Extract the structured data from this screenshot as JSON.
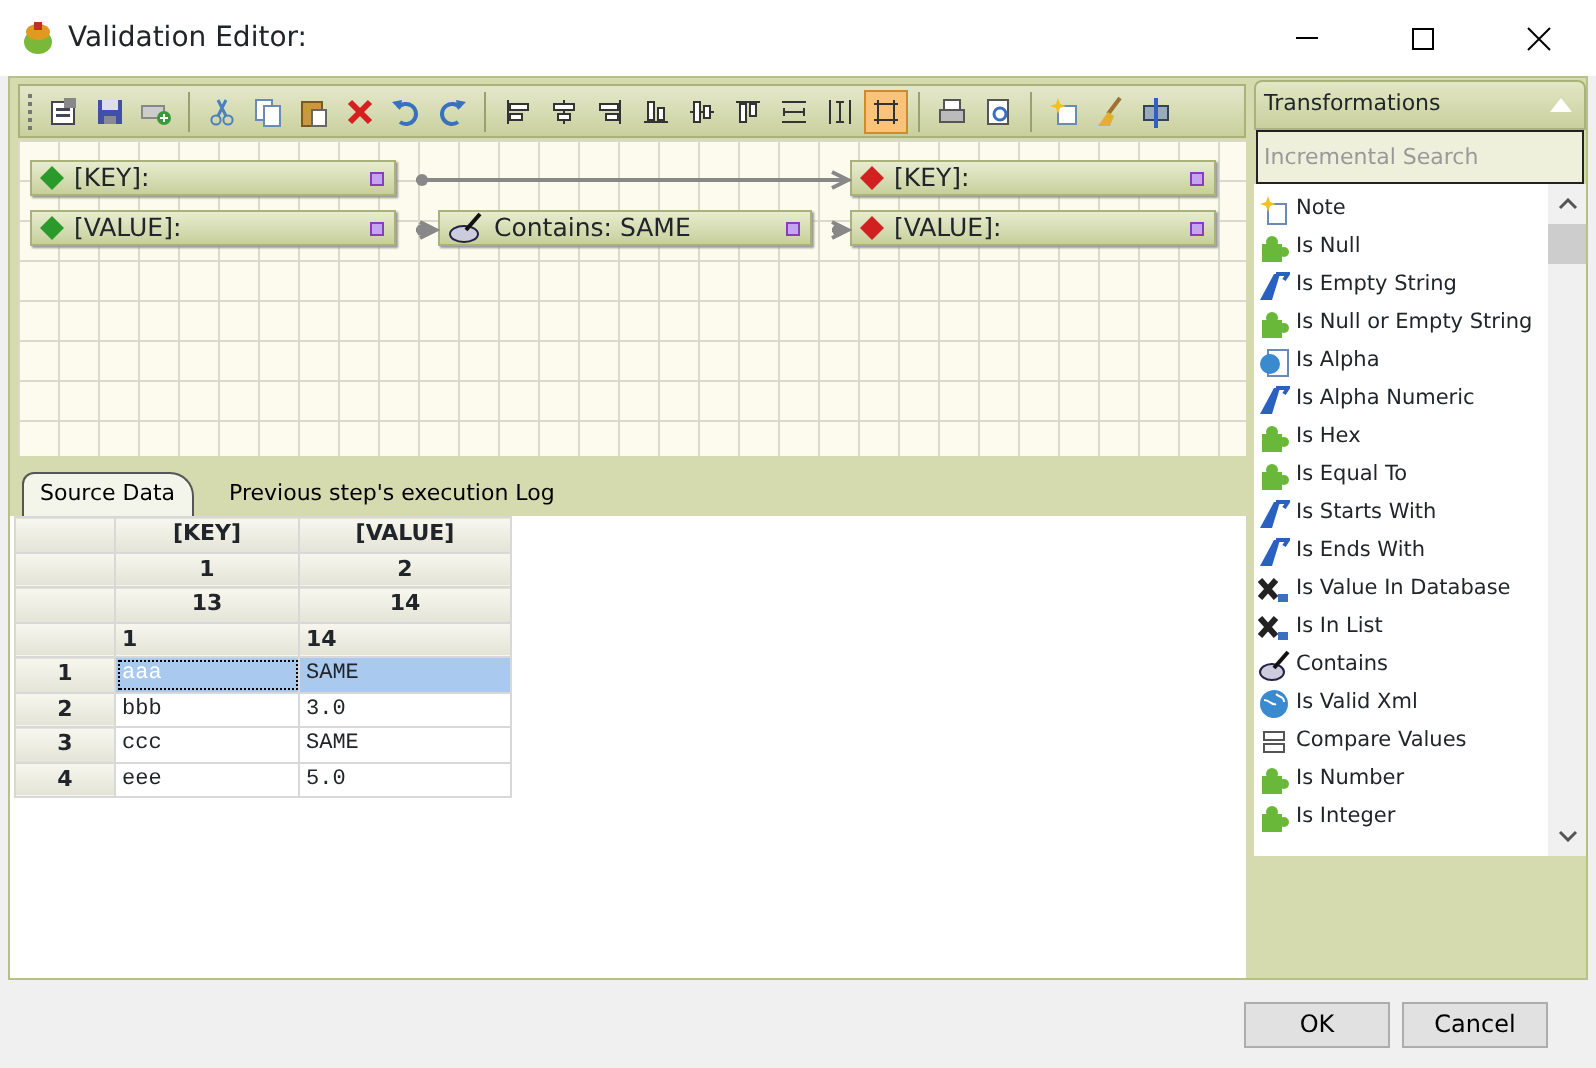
{
  "window": {
    "title": "Validation Editor:"
  },
  "toolbar_groups": [
    [
      {
        "pressed": false
      },
      {
        "pressed": false
      },
      {
        "pressed": false
      }
    ],
    [
      {
        "pressed": false
      },
      {
        "pressed": false
      },
      {
        "pressed": false
      },
      {
        "pressed": false
      },
      {
        "pressed": false
      },
      {
        "pressed": false
      }
    ],
    [
      {
        "pressed": false
      },
      {
        "pressed": false
      },
      {
        "pressed": false
      },
      {
        "pressed": false
      },
      {
        "pressed": false
      },
      {
        "pressed": false
      },
      {
        "pressed": false
      },
      {
        "pressed": false
      },
      {
        "pressed": true
      }
    ],
    [
      {
        "pressed": false
      },
      {
        "pressed": false
      }
    ],
    [
      {
        "pressed": false
      },
      {
        "pressed": false
      },
      {
        "pressed": false
      }
    ]
  ],
  "canvas": {
    "nodes": [
      {
        "kind": "source",
        "label": "[KEY]:"
      },
      {
        "kind": "source",
        "label": "[VALUE]:"
      },
      {
        "kind": "transform",
        "label": "Contains: SAME"
      },
      {
        "kind": "target",
        "label": "[KEY]:"
      },
      {
        "kind": "target",
        "label": "[VALUE]:"
      }
    ]
  },
  "tabs": [
    {
      "label": "Source Data",
      "selected": true
    },
    {
      "label": "Previous step's execution Log",
      "selected": false
    }
  ],
  "grid": {
    "header_rows": [
      [
        "[KEY]",
        "[VALUE]"
      ],
      [
        "1",
        "2"
      ],
      [
        "13",
        "14"
      ]
    ],
    "sub_header": [
      "1",
      "14"
    ],
    "rows": [
      {
        "number": "1",
        "selected": true,
        "cells": [
          "aaa",
          "SAME"
        ]
      },
      {
        "number": "2",
        "selected": false,
        "cells": [
          "bbb",
          "3.0"
        ]
      },
      {
        "number": "3",
        "selected": false,
        "cells": [
          "ccc",
          "SAME"
        ]
      },
      {
        "number": "4",
        "selected": false,
        "cells": [
          "eee",
          "5.0"
        ]
      }
    ]
  },
  "transformations": {
    "title": "Transformations",
    "search": {
      "placeholder": "Incremental Search"
    },
    "items": [
      {
        "kind": "note",
        "label": "Note"
      },
      {
        "kind": "puzzle",
        "label": "Is Null"
      },
      {
        "kind": "text",
        "label": "Is Empty String"
      },
      {
        "kind": "puzzle",
        "label": "Is Null or Empty String"
      },
      {
        "kind": "document",
        "label": "Is Alpha"
      },
      {
        "kind": "text",
        "label": "Is Alpha Numeric"
      },
      {
        "kind": "puzzle",
        "label": "Is Hex"
      },
      {
        "kind": "puzzle",
        "label": "Is Equal To"
      },
      {
        "kind": "text",
        "label": "Is Starts With"
      },
      {
        "kind": "text",
        "label": "Is Ends With"
      },
      {
        "kind": "lookup",
        "label": "Is Value In Database"
      },
      {
        "kind": "lookup",
        "label": "Is In List"
      },
      {
        "kind": "contains",
        "label": "Contains"
      },
      {
        "kind": "globe",
        "label": "Is Valid Xml"
      },
      {
        "kind": "compare",
        "label": "Compare Values"
      },
      {
        "kind": "puzzle",
        "label": "Is Number"
      },
      {
        "kind": "puzzle",
        "label": "Is Integer"
      }
    ]
  },
  "buttons": [
    "OK",
    "Cancel"
  ]
}
